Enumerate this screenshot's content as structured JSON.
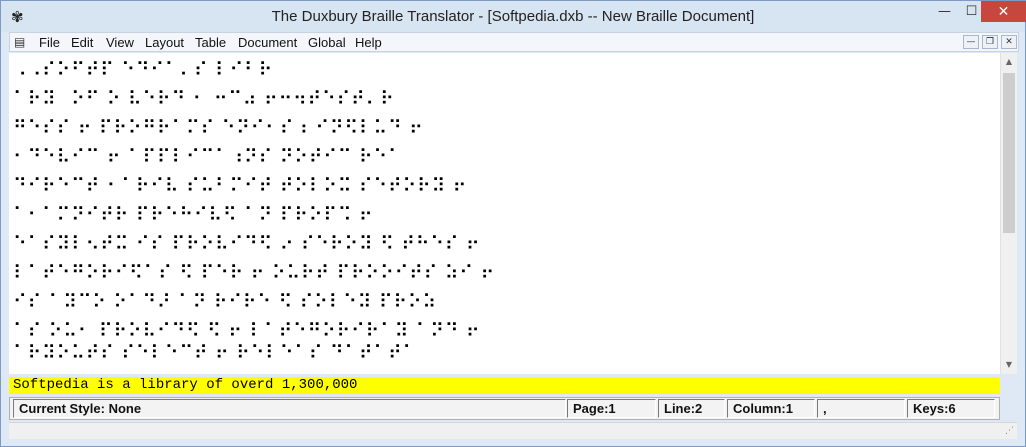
{
  "window": {
    "title": "The Duxbury Braille Translator - [Softpedia.dxb -- New Braille Document]",
    "controls": {
      "minimize": "—",
      "maximize": "☐",
      "close": "✕"
    }
  },
  "menubar": {
    "items": [
      "File",
      "Edit",
      "View",
      "Layout",
      "Table",
      "Document",
      "Global",
      "Help"
    ],
    "mdi": {
      "minimize": "—",
      "restore": "❐",
      "close": "✕"
    }
  },
  "editor": {
    "braille_lines": [
      "⠠⠠⠎⠕⠋⠞⠏ ⠑⠙⠊⠁⠄⠎ ⠇⠊⠃⠗",
      "⠁⠗⠽⠀⠕⠋ ⠕ ⠧⠑⠗⠙ ⠂ ⠒⠉⠴ ⠖⠒⠲⠞⠑⠎⠞⠄⠗",
      "⠛⠑⠎⠎ ⠖ ⠏⠗⠕⠛⠗⠁⠍⠎ ⠑⠝⠊⠂⠎⠰ ⠊⠝⠫⠇⠥⠙ ⠖",
      "⠂⠙⠑⠧⠊⠉ ⠖ ⠁⠏⠏⠇⠊⠉⠁⠰⠝⠎ ⠝⠕⠞⠊⠉ ⠗⠑⠁",
      "⠙⠊⠗⠑⠉⠞ ⠂⠁⠗⠊⠧ ⠎⠥⠃⠍⠊⠞ ⠞⠕⠇⠕⠭ ⠎⠑⠞⠕⠗⠽ ⠖",
      "⠁⠂⠁⠍⠝⠊⠞⠗ ⠏⠗⠑⠓⠊⠧⠫ ⠁⠝ ⠏⠗⠕⠏⠩ ⠖",
      "⠑⠁⠎⠽⠇⠢⠞⠭ ⠊⠎ ⠏⠗⠕⠧⠊⠙⠫ ⠔ ⠎⠑⠗⠕⠽ ⠫ ⠞⠓⠑⠎ ⠖",
      "⠇⠁⠞⠑⠛⠕⠗⠊⠫⠁⠎ ⠫ ⠏⠑⠗ ⠖ ⠕⠥⠗⠞ ⠏⠗⠕⠕⠊⠞⠎ ⠵⠊ ⠖",
      "⠊⠎ ⠁⠽⠉⠕ ⠕⠁⠙⠜ ⠁⠝ ⠗⠊⠗⠑ ⠫ ⠎⠕⠇⠑⠽ ⠏⠗⠕⠵",
      "⠁⠎ ⠕⠥⠂ ⠏⠗⠕⠧⠊⠙⠫ ⠫ ⠖ ⠇⠁⠞⠑⠛⠕⠗⠊⠗⠁⠽ ⠁⠝⠙ ⠖",
      "⠁⠗⠽⠕⠥⠞⠎ ⠎⠑⠇⠑⠉⠞ ⠖ ⠗⠑⠇⠑⠁⠎ ⠙⠁⠞⠁⠞⠁"
    ],
    "print_line": "Softpedia is a library of overd 1,300,000"
  },
  "statusbar": {
    "style": "Current Style: None",
    "page": "Page:1",
    "line": "Line:2",
    "column": "Column:1",
    "misc": ",",
    "keys": "Keys:6"
  },
  "icons": {
    "app": "✾",
    "doc": "▤",
    "scroll_up": "▲",
    "scroll_down": "▼",
    "scroll_left": "◀",
    "scroll_right": "▶",
    "grip": "⋰"
  },
  "colors": {
    "highlight": "#ffff00",
    "close_button": "#c7463d"
  }
}
